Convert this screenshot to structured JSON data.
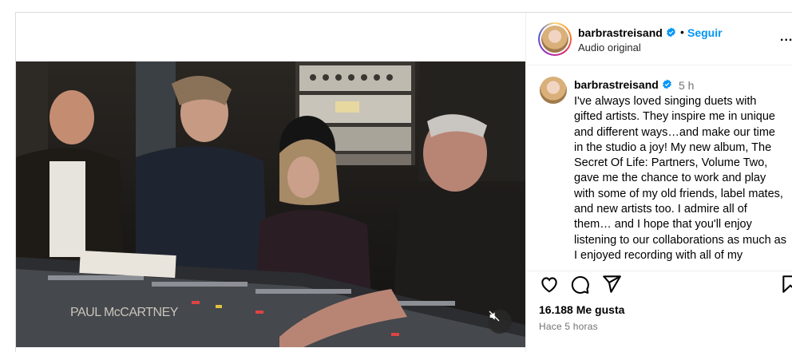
{
  "post": {
    "username": "barbrastreisand",
    "follow_label": "Seguir",
    "separator": "•",
    "audio_label": "Audio original",
    "more_label": "...",
    "media_caption": "PAUL McCARTNEY",
    "icons": {
      "verified": "verified-badge-icon",
      "mute": "speaker-muted-icon",
      "like": "heart-icon",
      "comment": "comment-bubble-icon",
      "share": "paper-plane-icon",
      "save": "bookmark-icon"
    },
    "colors": {
      "accent": "#0095f6",
      "verified": "#0095f6",
      "muted_text": "#737373"
    }
  },
  "comment": {
    "username": "barbrastreisand",
    "time": "5 h",
    "text": "I've always loved singing duets with gifted artists. They inspire me in unique and different ways…and make our time in the studio a joy! My new album, The Secret Of Life: Partners, Volume Two, gave me the chance to work and play with some of my old friends, label mates, and new artists too. I admire all of them… and I hope that you'll enjoy listening to our collaborations as much as I enjoyed recording with all of my"
  },
  "stats": {
    "likes": "16.188 Me gusta",
    "time_ago": "Hace 5 horas"
  }
}
